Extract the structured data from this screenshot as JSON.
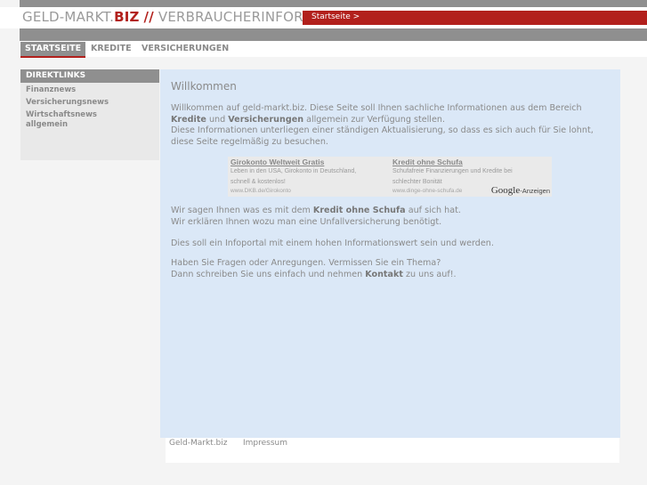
{
  "header": {
    "logo_main": "GELD-MARKT.",
    "logo_biz": "BIZ",
    "logo_sep": "//",
    "logo_tagline": "VERBRAUCHERINFORMATIONEN",
    "start_link": "Startseite >"
  },
  "nav": {
    "items": [
      {
        "label": "STARTSEITE",
        "active": true
      },
      {
        "label": "KREDITE",
        "active": false
      },
      {
        "label": "VERSICHERUNGEN",
        "active": false
      }
    ]
  },
  "sidebar": {
    "heading": "DIREKTLINKS",
    "items": [
      {
        "label": "Finanznews"
      },
      {
        "label": "Versicherungsnews"
      },
      {
        "label": "Wirtschaftsnews allgemein"
      }
    ]
  },
  "main": {
    "title": "Willkommen",
    "intro": {
      "l1": "Willkommen auf geld-markt.biz. Diese Seite soll Ihnen sachliche Informationen aus dem Bereich",
      "kredite": "Kredite",
      "und": " und ",
      "versicherungen": "Versicherungen",
      "l2_rest": " allgemein zur Verfügung stellen.",
      "l3": "Diese Informationen unterliegen einer ständigen Aktualisierung, so dass es sich auch für Sie lohnt,",
      "l4": "diese Seite regelmäßig zu besuchen."
    },
    "p2": {
      "l1_pre": "Wir sagen Ihnen was es mit dem ",
      "l1_bold": "Kredit ohne Schufa",
      "l1_post": " auf sich hat.",
      "l2": "Wir erklären Ihnen wozu man eine Unfallversicherung benötigt."
    },
    "p3": "Dies soll ein Infoportal mit einem hohen Informationswert sein und werden.",
    "p4": {
      "l1": "Haben Sie Fragen oder Anregungen. Vermissen Sie ein Thema?",
      "l2_pre": "Dann schreiben Sie uns einfach und nehmen ",
      "l2_bold": "Kontakt",
      "l2_post": " zu uns auf!."
    }
  },
  "ads": [
    {
      "title": "Girokonto Weltweit Gratis",
      "line1": "Leben in den USA, Girokonto in Deutschland,",
      "line2": "schnell & kostenlos!",
      "url": "www.DKB.de/Girokonto"
    },
    {
      "title": "Kredit ohne Schufa",
      "line1": "Schufafreie Finanzierungen und Kredite bei",
      "line2": "schlechter Bonität",
      "url": "www.dinge-ohne-schufa.de"
    }
  ],
  "ads_label": {
    "brand": "Google",
    "suffix": "-Anzeigen"
  },
  "footer": {
    "links": [
      {
        "label": "Geld-Markt.biz"
      },
      {
        "label": "Impressum"
      }
    ]
  }
}
